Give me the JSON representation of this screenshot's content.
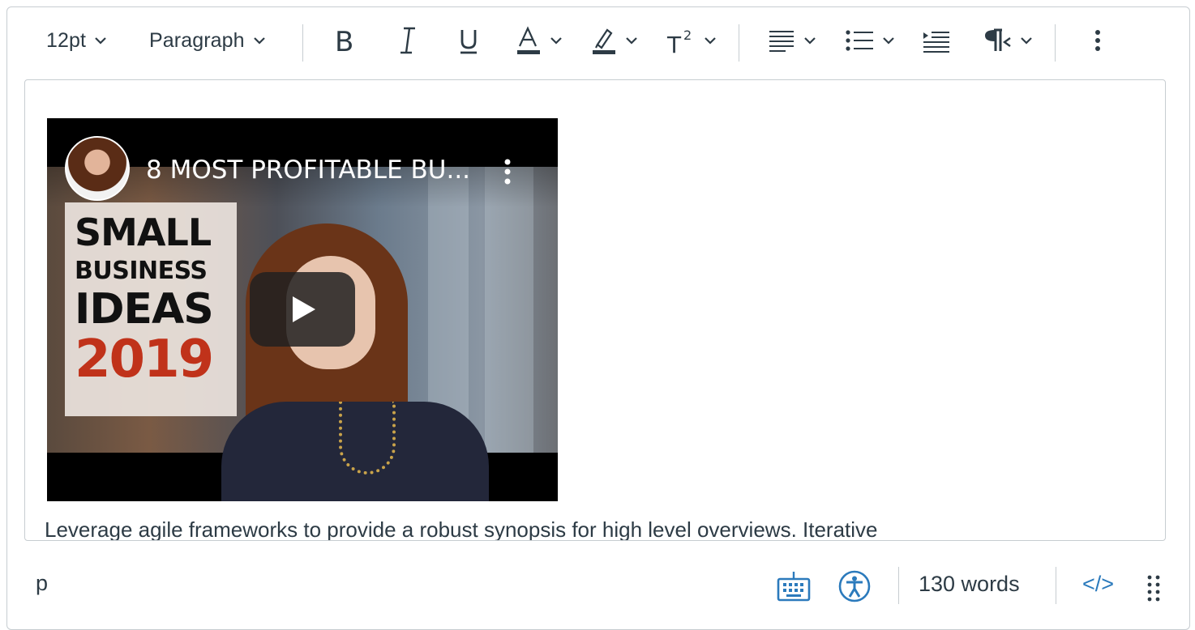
{
  "toolbar": {
    "font_size": "12pt",
    "block_format": "Paragraph",
    "bold_icon": "bold-icon",
    "italic_icon": "italic-icon",
    "underline_icon": "underline-icon",
    "text_color_icon": "text-color-icon",
    "highlight_icon": "highlight-icon",
    "superscript_icon": "superscript-icon",
    "align_icon": "align-icon",
    "list_icon": "bullet-list-icon",
    "indent_icon": "indent-icon",
    "direction_icon": "paragraph-direction-icon",
    "more_icon": "more-vertical-icon"
  },
  "video": {
    "title": "8 MOST PROFITABLE BU...",
    "thumbnail_lines": [
      "SMALL",
      "BUSINESS",
      "IDEAS",
      "2019"
    ]
  },
  "editor": {
    "text": "Leverage agile frameworks to provide a robust synopsis for high level overviews. Iterative"
  },
  "statusbar": {
    "path": "p",
    "word_count": "130 words",
    "html_toggle": "</>",
    "keyboard_icon": "keyboard-icon",
    "accessibility_icon": "accessibility-icon",
    "resize_icon": "resize-grip-icon"
  },
  "colors": {
    "text": "#2d3b45",
    "border": "#c7cdd1",
    "accent": "#2b7abc",
    "year_red": "#c0321a"
  }
}
